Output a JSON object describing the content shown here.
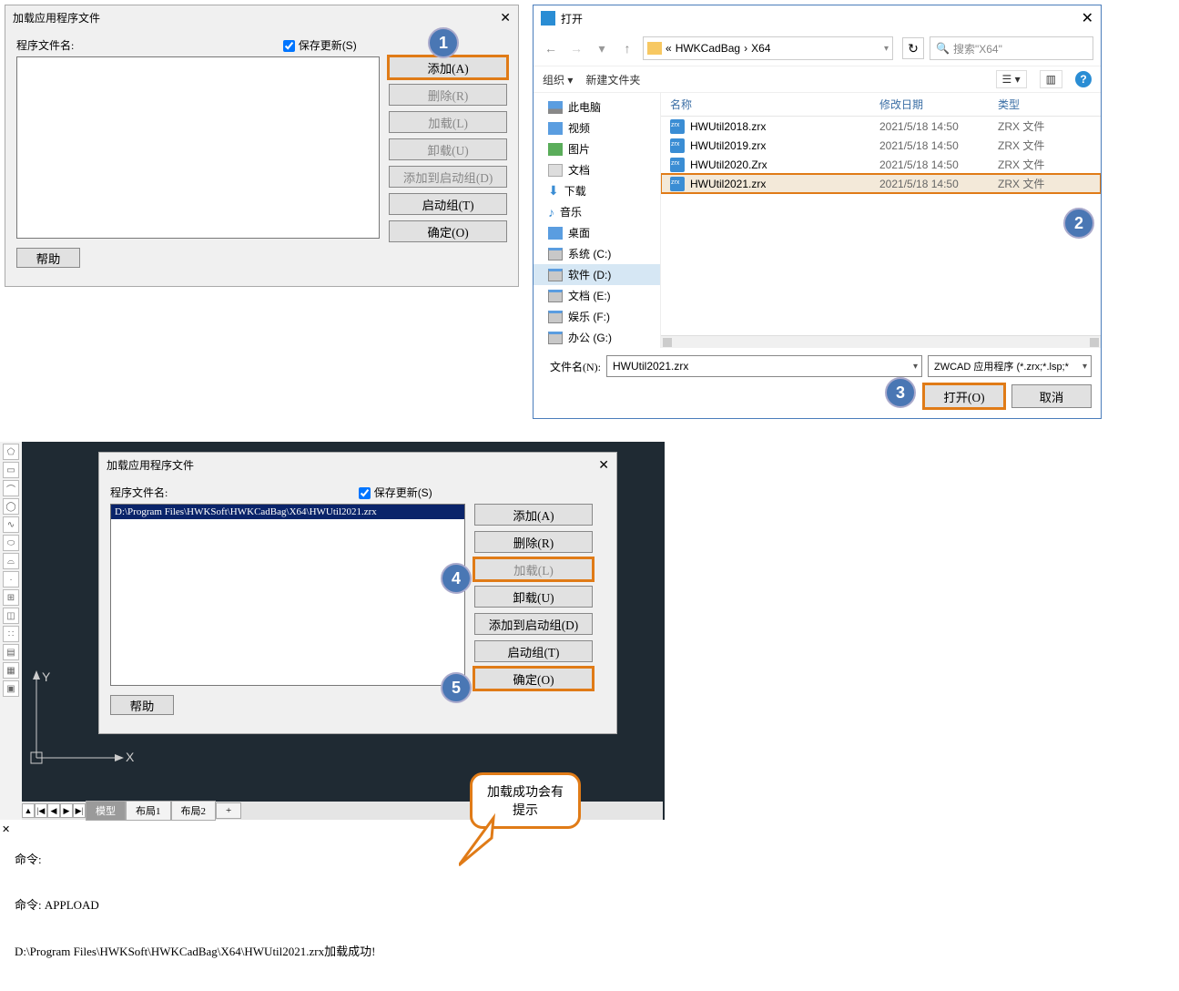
{
  "dlg1": {
    "title": "加载应用程序文件",
    "label_program": "程序文件名:",
    "save_updates": "保存更新(S)",
    "buttons": {
      "add": "添加(A)",
      "del": "删除(R)",
      "load": "加载(L)",
      "unload": "卸载(U)",
      "addstart": "添加到启动组(D)",
      "startgrp": "启动组(T)",
      "ok": "确定(O)"
    },
    "help": "帮助"
  },
  "dlg2": {
    "title": "打开",
    "breadcrumbs": {
      "prefix": "«",
      "p1": "HWKCadBag",
      "sep": "›",
      "p2": "X64"
    },
    "search_placeholder": "搜索\"X64\"",
    "organize": "组织 ▾",
    "new_folder": "新建文件夹",
    "cols": {
      "name": "名称",
      "date": "修改日期",
      "type": "类型"
    },
    "tree": [
      "此电脑",
      "视频",
      "图片",
      "文档",
      "下载",
      "音乐",
      "桌面",
      "系统 (C:)",
      "软件 (D:)",
      "文档 (E:)",
      "娱乐 (F:)",
      "办公 (G:)"
    ],
    "files": [
      {
        "name": "HWUtil2018.zrx",
        "date": "2021/5/18 14:50",
        "type": "ZRX 文件"
      },
      {
        "name": "HWUtil2019.zrx",
        "date": "2021/5/18 14:50",
        "type": "ZRX 文件"
      },
      {
        "name": "HWUtil2020.Zrx",
        "date": "2021/5/18 14:50",
        "type": "ZRX 文件"
      },
      {
        "name": "HWUtil2021.zrx",
        "date": "2021/5/18 14:50",
        "type": "ZRX 文件"
      }
    ],
    "filename_label": "文件名(N):",
    "filename_value": "HWUtil2021.zrx",
    "type_filter": "ZWCAD 应用程序 (*.zrx;*.lsp;*",
    "open": "打开(O)",
    "cancel": "取消"
  },
  "dlg3": {
    "title": "加载应用程序文件",
    "selected_path": "D:\\Program Files\\HWKSoft\\HWKCadBag\\X64\\HWUtil2021.zrx"
  },
  "cad_tabs": {
    "model": "模型",
    "layout1": "布局1",
    "layout2": "布局2",
    "plus": "+"
  },
  "axes": {
    "x": "X",
    "y": "Y"
  },
  "console": {
    "l1": "命令:",
    "l2": "命令: APPLOAD",
    "l3": "D:\\Program Files\\HWKSoft\\HWKCadBag\\X64\\HWUtil2021.zrx加载成功!"
  },
  "callout": {
    "l1": "加载成功会有",
    "l2": "提示"
  },
  "steps": {
    "s1": "1",
    "s2": "2",
    "s3": "3",
    "s4": "4",
    "s5": "5"
  }
}
